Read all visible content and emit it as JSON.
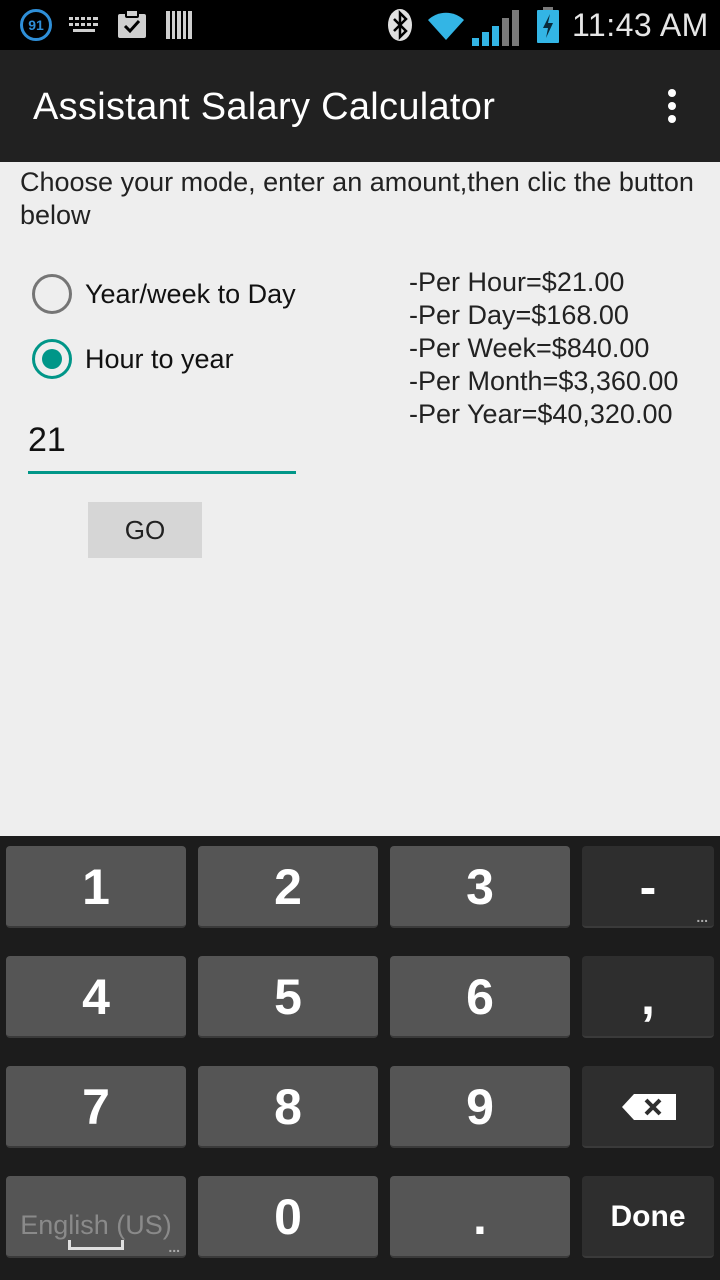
{
  "status_bar": {
    "badge": "91",
    "time": "11:43 AM",
    "icons": [
      "notification-91-icon",
      "keyboard-icon",
      "clipboard-check-icon",
      "barcode-icon",
      "bluetooth-icon",
      "wifi-icon",
      "cell-signal-icon",
      "battery-charging-icon"
    ]
  },
  "app_bar": {
    "title": "Assistant Salary Calculator",
    "menu_icon": "overflow-menu-icon"
  },
  "main": {
    "instructions": "Choose your mode, enter an amount,then clic the button below",
    "modes": [
      {
        "label": "Year/week to Day",
        "checked": false
      },
      {
        "label": "Hour to year",
        "checked": true
      }
    ],
    "amount_value": "21",
    "go_label": "GO",
    "results": [
      "-Per Hour=$21.00",
      "-Per Day=$168.00",
      "-Per Week=$840.00",
      "-Per Month=$3,360.00",
      "-Per Year=$40,320.00"
    ]
  },
  "keyboard": {
    "row1": [
      "1",
      "2",
      "3",
      "-"
    ],
    "row2": [
      "4",
      "5",
      "6",
      ","
    ],
    "row3": [
      "7",
      "8",
      "9"
    ],
    "row4": [
      "English (US)",
      "0",
      ".",
      "Done"
    ],
    "backspace_icon": "backspace-icon",
    "accent_color": "#009688"
  }
}
